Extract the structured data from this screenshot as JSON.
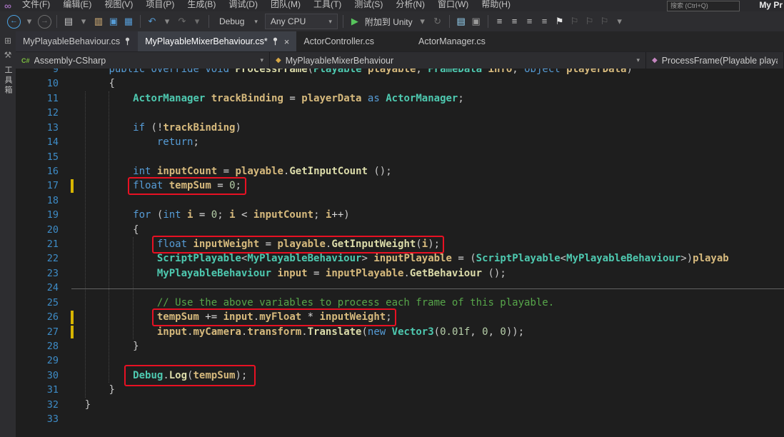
{
  "window": {
    "title_right": "My Pr",
    "search_placeholder": "搜索 (Ctrl+Q)"
  },
  "menu": {
    "items": [
      "文件(F)",
      "编辑(E)",
      "视图(V)",
      "项目(P)",
      "生成(B)",
      "调试(D)",
      "团队(M)",
      "工具(T)",
      "测试(S)",
      "分析(N)",
      "窗口(W)",
      "帮助(H)"
    ]
  },
  "toolbar": {
    "items": [
      {
        "name": "nav-back-button",
        "glyph": "←",
        "color": "#4BA3E3",
        "cls": "circle"
      },
      {
        "name": "nav-back-dropdown",
        "glyph": "▾",
        "color": "#8A8A8A"
      },
      {
        "name": "nav-forward-button",
        "glyph": "→",
        "color": "#6E6E6E",
        "cls": "circle"
      },
      {
        "name": "sep1",
        "sep": true
      },
      {
        "name": "new-file-button",
        "glyph": "▤",
        "color": "#C8C8C8"
      },
      {
        "name": "new-file-dropdown",
        "glyph": "▾",
        "color": "#8A8A8A"
      },
      {
        "name": "open-file-button",
        "glyph": "▥",
        "color": "#DCB67A"
      },
      {
        "name": "save-button",
        "glyph": "▣",
        "color": "#569CD6"
      },
      {
        "name": "save-all-button",
        "glyph": "▦",
        "color": "#569CD6"
      },
      {
        "name": "sep2",
        "sep": true
      },
      {
        "name": "undo-button",
        "glyph": "↶",
        "color": "#569CD6"
      },
      {
        "name": "undo-dropdown",
        "glyph": "▾",
        "color": "#8A8A8A"
      },
      {
        "name": "redo-button",
        "glyph": "↷",
        "color": "#6E6E6E"
      },
      {
        "name": "redo-dropdown",
        "glyph": "▾",
        "color": "#6E6E6E"
      },
      {
        "name": "sep3",
        "sep": true
      },
      {
        "name": "configuration-combo",
        "combo": "Debug"
      },
      {
        "name": "platform-combo",
        "combo": "Any CPU",
        "boxed": true
      },
      {
        "name": "sep4",
        "sep": true
      },
      {
        "name": "attach-to-unity-button",
        "glyph": "▶",
        "color": "#57C45C",
        "label": "附加到 Unity"
      },
      {
        "name": "attach-to-unity-dropdown",
        "glyph": "▾",
        "color": "#8A8A8A"
      },
      {
        "name": "hot-reload-button",
        "glyph": "↻",
        "color": "#6E6E6E"
      },
      {
        "name": "sep5",
        "sep": true
      },
      {
        "name": "preview-button",
        "glyph": "▤",
        "color": "#9CDCFE"
      },
      {
        "name": "console-window-button",
        "glyph": "▣",
        "color": "#9A9A9A"
      },
      {
        "name": "sep6",
        "sep": true
      },
      {
        "name": "indent-decrease-button",
        "glyph": "≡",
        "color": "#D0D0D0"
      },
      {
        "name": "indent-increase-button",
        "glyph": "≡",
        "color": "#D0D0D0"
      },
      {
        "name": "comment-button",
        "glyph": "≡",
        "color": "#C0C0C0"
      },
      {
        "name": "uncomment-button",
        "glyph": "≡",
        "color": "#C0C0C0"
      },
      {
        "name": "bookmark-button",
        "glyph": "⚑",
        "color": "#E8E8E8"
      },
      {
        "name": "prev-bookmark-button",
        "glyph": "⚐",
        "color": "#6E6E6E"
      },
      {
        "name": "next-bookmark-button",
        "glyph": "⚐",
        "color": "#6E6E6E"
      },
      {
        "name": "clear-bookmarks-button",
        "glyph": "⚐",
        "color": "#6E6E6E"
      },
      {
        "name": "toolbar-overflow-button",
        "glyph": "▾",
        "color": "#8A8A8A"
      }
    ]
  },
  "side_strip": {
    "vertical_label": "工具箱"
  },
  "tabs": [
    {
      "label": "MyPlayableBehaviour.cs",
      "pinned": true,
      "active": false
    },
    {
      "label": "MyPlayableMixerBehaviour.cs*",
      "pinned": true,
      "active": true
    },
    {
      "label": "ActorController.cs",
      "pinned": false,
      "active": false
    },
    {
      "label": "ActorManager.cs",
      "pinned": false,
      "active": false
    }
  ],
  "breadcrumb": {
    "sections": [
      {
        "icon": "csharp-project-icon",
        "label": "Assembly-CSharp"
      },
      {
        "icon": "class-icon",
        "label": "MyPlayableMixerBehaviour"
      },
      {
        "icon": "method-icon",
        "label": "ProcessFrame(Playable playab"
      }
    ]
  },
  "editor": {
    "first_line": 9,
    "current_line": 24,
    "changed_lines": [
      17,
      26,
      27
    ],
    "annotations": [
      {
        "line": 17,
        "col": 12,
        "len": 18
      },
      {
        "line": 21,
        "col": 16,
        "len": 47
      },
      {
        "line": 26,
        "col": 16,
        "len": 39
      },
      {
        "line": 30,
        "col": 12,
        "len": 19,
        "padx": 12,
        "pady": 5
      }
    ],
    "lines": [
      {
        "n": 9,
        "t": [
          [
            "ws",
            "        "
          ],
          [
            "kw",
            "public"
          ],
          [
            "ws",
            " "
          ],
          [
            "kw",
            "override"
          ],
          [
            "ws",
            " "
          ],
          [
            "kw",
            "void"
          ],
          [
            "ws",
            " "
          ],
          [
            "mth",
            "ProcessFrame"
          ],
          [
            "pn",
            "("
          ],
          [
            "ty",
            "Playable"
          ],
          [
            "ws",
            " "
          ],
          [
            "id",
            "playable"
          ],
          [
            "pn",
            ", "
          ],
          [
            "ty",
            "FrameData"
          ],
          [
            "ws",
            " "
          ],
          [
            "id",
            "info"
          ],
          [
            "pn",
            ", "
          ],
          [
            "kw",
            "object"
          ],
          [
            "ws",
            " "
          ],
          [
            "id",
            "playerData"
          ],
          [
            "pn",
            ")"
          ]
        ]
      },
      {
        "n": 10,
        "t": [
          [
            "ws",
            "        "
          ],
          [
            "pn",
            "{"
          ]
        ]
      },
      {
        "n": 11,
        "t": [
          [
            "ws",
            "            "
          ],
          [
            "ty",
            "ActorManager"
          ],
          [
            "ws",
            " "
          ],
          [
            "id",
            "trackBinding"
          ],
          [
            "op",
            " = "
          ],
          [
            "id",
            "playerData"
          ],
          [
            "kw",
            " as "
          ],
          [
            "ty",
            "ActorManager"
          ],
          [
            "pn",
            ";"
          ]
        ]
      },
      {
        "n": 12,
        "t": []
      },
      {
        "n": 13,
        "t": [
          [
            "ws",
            "            "
          ],
          [
            "kw",
            "if"
          ],
          [
            "pn",
            " ("
          ],
          [
            "op",
            "!"
          ],
          [
            "id",
            "trackBinding"
          ],
          [
            "pn",
            ")"
          ]
        ]
      },
      {
        "n": 14,
        "t": [
          [
            "ws",
            "                "
          ],
          [
            "kw",
            "return"
          ],
          [
            "pn",
            ";"
          ]
        ]
      },
      {
        "n": 15,
        "t": []
      },
      {
        "n": 16,
        "t": [
          [
            "ws",
            "            "
          ],
          [
            "kw",
            "int"
          ],
          [
            "ws",
            " "
          ],
          [
            "id",
            "inputCount"
          ],
          [
            "op",
            " = "
          ],
          [
            "id",
            "playable"
          ],
          [
            "pn",
            "."
          ],
          [
            "mth",
            "GetInputCount"
          ],
          [
            "pn",
            " ();"
          ]
        ]
      },
      {
        "n": 17,
        "t": [
          [
            "ws",
            "            "
          ],
          [
            "kw",
            "float"
          ],
          [
            "ws",
            " "
          ],
          [
            "id",
            "tempSum"
          ],
          [
            "op",
            " = "
          ],
          [
            "num",
            "0"
          ],
          [
            "pn",
            ";"
          ]
        ]
      },
      {
        "n": 18,
        "t": []
      },
      {
        "n": 19,
        "t": [
          [
            "ws",
            "            "
          ],
          [
            "kw",
            "for"
          ],
          [
            "pn",
            " ("
          ],
          [
            "kw",
            "int"
          ],
          [
            "ws",
            " "
          ],
          [
            "id",
            "i"
          ],
          [
            "op",
            " = "
          ],
          [
            "num",
            "0"
          ],
          [
            "pn",
            "; "
          ],
          [
            "id",
            "i"
          ],
          [
            "op",
            " < "
          ],
          [
            "id",
            "inputCount"
          ],
          [
            "pn",
            "; "
          ],
          [
            "id",
            "i"
          ],
          [
            "op",
            "++"
          ],
          [
            "pn",
            ")"
          ]
        ]
      },
      {
        "n": 20,
        "t": [
          [
            "ws",
            "            "
          ],
          [
            "pn",
            "{"
          ]
        ]
      },
      {
        "n": 21,
        "t": [
          [
            "ws",
            "                "
          ],
          [
            "kw",
            "float"
          ],
          [
            "ws",
            " "
          ],
          [
            "id",
            "inputWeight"
          ],
          [
            "op",
            " = "
          ],
          [
            "id",
            "playable"
          ],
          [
            "pn",
            "."
          ],
          [
            "mth",
            "GetInputWeight"
          ],
          [
            "pn",
            "("
          ],
          [
            "id",
            "i"
          ],
          [
            "pn",
            ");"
          ]
        ]
      },
      {
        "n": 22,
        "t": [
          [
            "ws",
            "                "
          ],
          [
            "ty",
            "ScriptPlayable"
          ],
          [
            "pn",
            "<"
          ],
          [
            "ty",
            "MyPlayableBehaviour"
          ],
          [
            "pn",
            ">"
          ],
          [
            "ws",
            " "
          ],
          [
            "id",
            "inputPlayable"
          ],
          [
            "op",
            " = "
          ],
          [
            "pn",
            "("
          ],
          [
            "ty",
            "ScriptPlayable"
          ],
          [
            "pn",
            "<"
          ],
          [
            "ty",
            "MyPlayableBehaviour"
          ],
          [
            "pn",
            ">)"
          ],
          [
            "id",
            "playab"
          ]
        ]
      },
      {
        "n": 23,
        "t": [
          [
            "ws",
            "                "
          ],
          [
            "ty",
            "MyPlayableBehaviour"
          ],
          [
            "ws",
            " "
          ],
          [
            "id",
            "input"
          ],
          [
            "op",
            " = "
          ],
          [
            "id",
            "inputPlayable"
          ],
          [
            "pn",
            "."
          ],
          [
            "mth",
            "GetBehaviour"
          ],
          [
            "pn",
            " ();"
          ]
        ]
      },
      {
        "n": 24,
        "t": []
      },
      {
        "n": 25,
        "t": [
          [
            "ws",
            "                "
          ],
          [
            "cm",
            "// Use the above variables to process each frame of this playable."
          ]
        ]
      },
      {
        "n": 26,
        "t": [
          [
            "ws",
            "                "
          ],
          [
            "id",
            "tempSum"
          ],
          [
            "op",
            " += "
          ],
          [
            "id",
            "input"
          ],
          [
            "pn",
            "."
          ],
          [
            "id",
            "myFloat"
          ],
          [
            "op",
            " * "
          ],
          [
            "id",
            "inputWeight"
          ],
          [
            "pn",
            ";"
          ]
        ]
      },
      {
        "n": 27,
        "t": [
          [
            "ws",
            "                "
          ],
          [
            "id",
            "input"
          ],
          [
            "pn",
            "."
          ],
          [
            "id",
            "myCamera"
          ],
          [
            "pn",
            "."
          ],
          [
            "id",
            "transform"
          ],
          [
            "pn",
            "."
          ],
          [
            "mth",
            "Translate"
          ],
          [
            "pn",
            "("
          ],
          [
            "kw",
            "new"
          ],
          [
            "ws",
            " "
          ],
          [
            "ty",
            "Vector3"
          ],
          [
            "pn",
            "("
          ],
          [
            "num",
            "0.01f"
          ],
          [
            "pn",
            ", "
          ],
          [
            "num",
            "0"
          ],
          [
            "pn",
            ", "
          ],
          [
            "num",
            "0"
          ],
          [
            "pn",
            "));"
          ]
        ]
      },
      {
        "n": 28,
        "t": [
          [
            "ws",
            "            "
          ],
          [
            "pn",
            "}"
          ]
        ]
      },
      {
        "n": 29,
        "t": []
      },
      {
        "n": 30,
        "t": [
          [
            "ws",
            "            "
          ],
          [
            "ty",
            "Debug"
          ],
          [
            "pn",
            "."
          ],
          [
            "mth",
            "Log"
          ],
          [
            "pn",
            "("
          ],
          [
            "id",
            "tempSum"
          ],
          [
            "pn",
            ");"
          ]
        ]
      },
      {
        "n": 31,
        "t": [
          [
            "ws",
            "        "
          ],
          [
            "pn",
            "}"
          ]
        ]
      },
      {
        "n": 32,
        "t": [
          [
            "ws",
            "    "
          ],
          [
            "pn",
            "}"
          ]
        ]
      },
      {
        "n": 33,
        "t": []
      }
    ]
  },
  "colors": {
    "accent": "#007ACC",
    "editor_bg": "#1E1E1E",
    "chrome_bg": "#2D2D30",
    "tabbar_bg": "#252526",
    "annotation": "#E81123",
    "change_bar": "#D7B500",
    "keyword": "#569CD6",
    "type": "#4EC9B0",
    "identifier": "#D7BA7D",
    "method": "#DCDCAA",
    "number": "#B5CEA8",
    "comment": "#57A64A",
    "line_number": "#3E8CC7"
  }
}
